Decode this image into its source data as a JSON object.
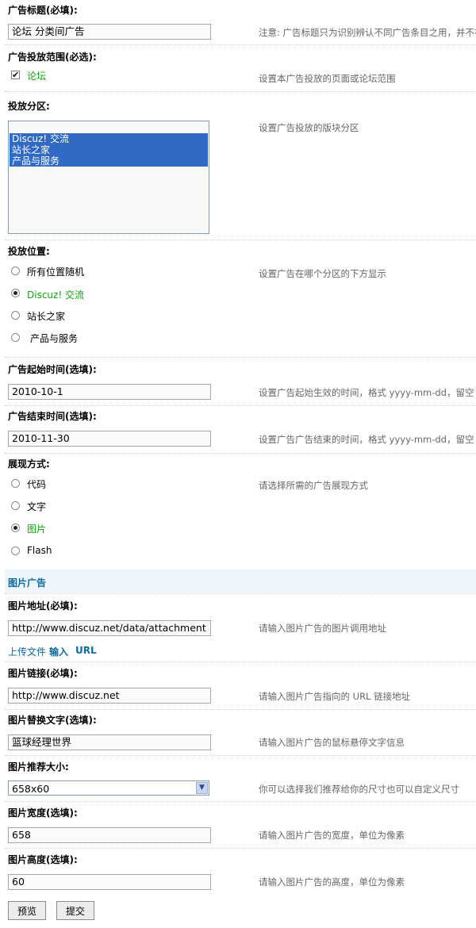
{
  "fields": {
    "title": {
      "label": "广告标题(必填):",
      "value": "论坛 分类间广告",
      "tip": "注意: 广告标题只为识别辨认不同广告条目之用，并不在"
    },
    "scope": {
      "label": "广告投放范围(必选):",
      "option": "论坛",
      "checked": true,
      "tip": "设置本广告投放的页面或论坛范围"
    },
    "zones": {
      "label": "投放分区:",
      "options": [
        "Discuz! 交流",
        "站长之家",
        "产品与服务"
      ],
      "tip": "设置广告投放的版块分区"
    },
    "position": {
      "label": "投放位置:",
      "options": [
        "所有位置随机",
        "Discuz! 交流",
        "站长之家",
        "产品与服务"
      ],
      "selected_index": 1,
      "tip": "设置广告在哪个分区的下方显示"
    },
    "start_time": {
      "label": "广告起始时间(选填):",
      "value": "2010-10-1",
      "tip": "设置广告起始生效的时间，格式 yyyy-mm-dd，留空"
    },
    "end_time": {
      "label": "广告结束时间(选填):",
      "value": "2010-11-30",
      "tip": "设置广告广告结束的时间，格式 yyyy-mm-dd，留空"
    },
    "display": {
      "label": "展现方式:",
      "options": [
        "代码",
        "文字",
        "图片",
        "Flash"
      ],
      "selected_index": 2,
      "tip": "请选择所需的广告展现方式"
    }
  },
  "image_section": {
    "title": "图片广告",
    "url": {
      "label": "图片地址(必填):",
      "value": "http://www.discuz.net/data/attachment",
      "tip": "请输入图片广告的图片调用地址"
    },
    "upload_links": {
      "upload": "上传文件",
      "input": "输入",
      "url": "URL"
    },
    "link": {
      "label": "图片链接(必填):",
      "value": "http://www.discuz.net",
      "tip": "请输入图片广告指向的 URL 链接地址"
    },
    "alt": {
      "label": "图片替换文字(选填):",
      "value": "篮球经理世界",
      "tip": "请输入图片广告的鼠标悬停文字信息"
    },
    "size": {
      "label": "图片推荐大小:",
      "value": "658x60",
      "tip": "你可以选择我们推荐给你的尺寸也可以自定义尺寸"
    },
    "width": {
      "label": "图片宽度(选填):",
      "value": "658",
      "tip": "请输入图片广告的宽度，单位为像素"
    },
    "height": {
      "label": "图片高度(选填):",
      "value": "60",
      "tip": "请输入图片广告的高度，单位为像素"
    }
  },
  "buttons": {
    "preview": "预览",
    "submit": "提交"
  },
  "colors": {
    "selected_option_text": "#11a411",
    "link": "#0e6aa0",
    "section_bg": "#eef5fb",
    "listbox_selection": "#316ac5"
  },
  "icons": {
    "checkbox": "check-icon",
    "select": "chevron-down-icon"
  }
}
